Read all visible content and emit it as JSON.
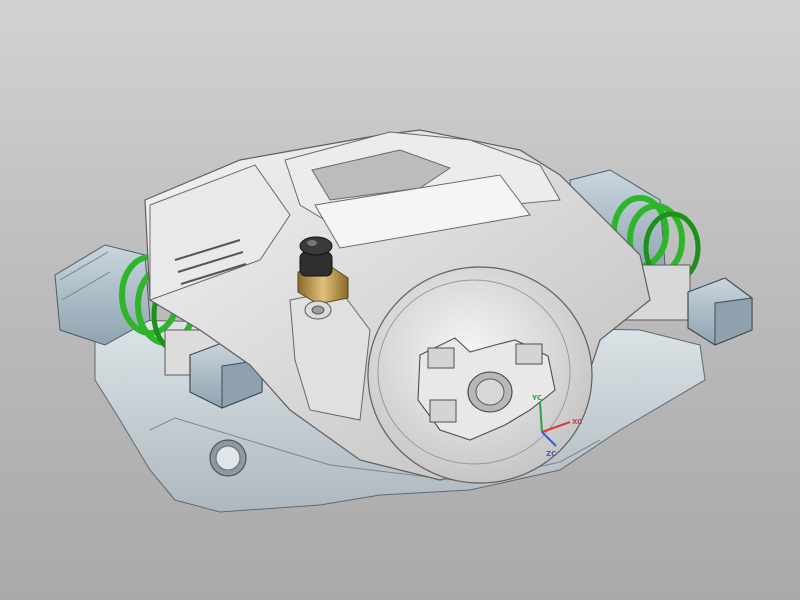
{
  "viewport": {
    "background_top": "#d2d2d2",
    "background_bottom": "#a9a9a9"
  },
  "model": {
    "body_color": "#e4e4e4",
    "bracket_color": "#cfd7dc",
    "boot_color": "#b7c7d1",
    "spring_color": "#2fb52a",
    "fitting_color": "#c9a24a"
  },
  "triad": {
    "x_label": "XC",
    "y_label": "YC",
    "z_label": "ZC",
    "x_color": "#e23a3a",
    "y_color": "#2fa24a",
    "z_color": "#2e5fe0"
  }
}
